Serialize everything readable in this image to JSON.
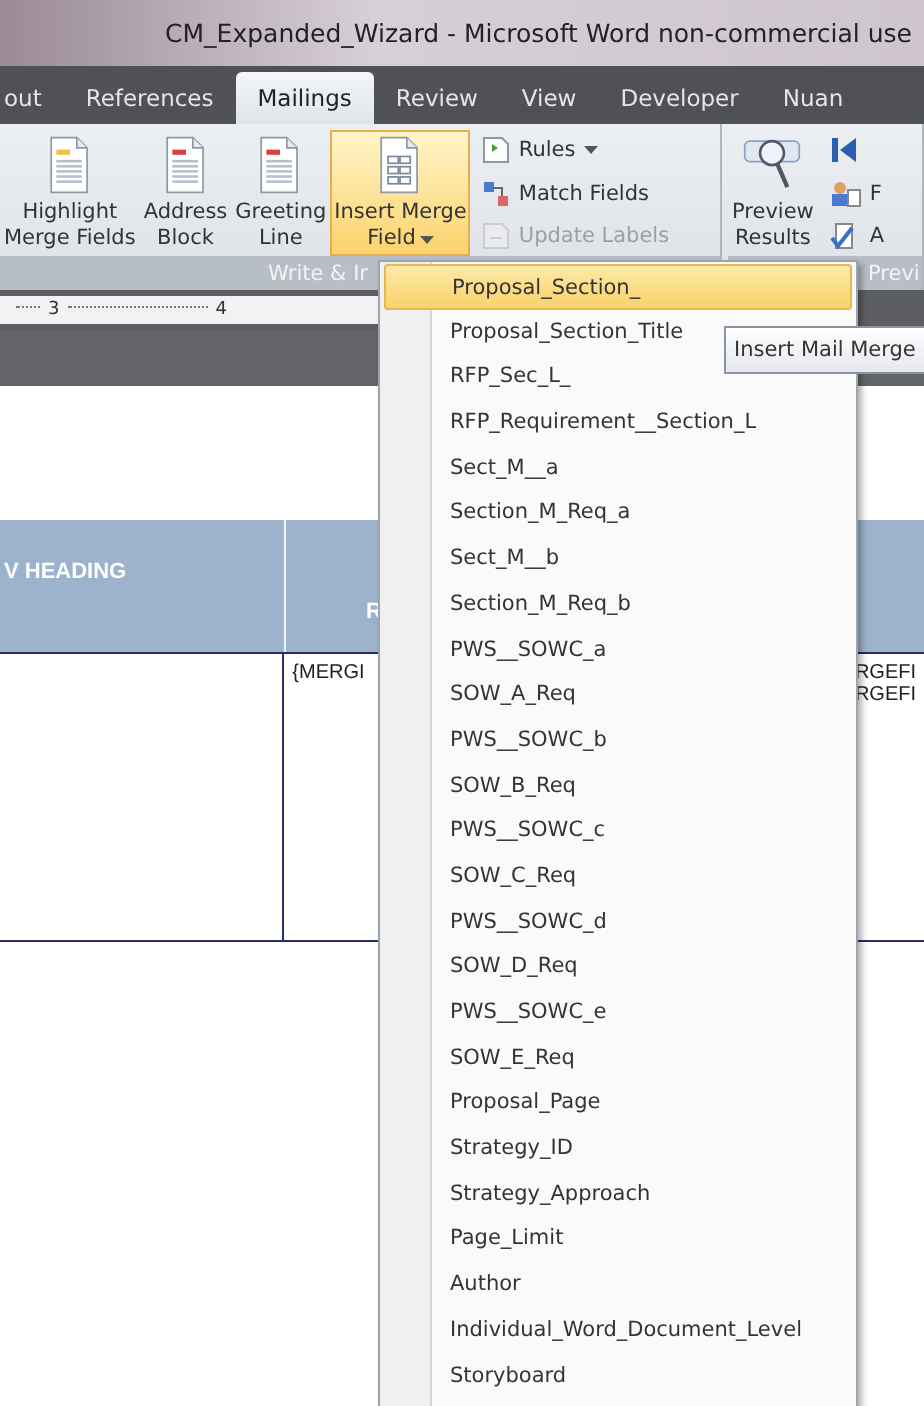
{
  "window": {
    "title": "CM_Expanded_Wizard - Microsoft Word non-commercial use"
  },
  "tabs": [
    {
      "label": "out",
      "selected": false
    },
    {
      "label": "References",
      "selected": false
    },
    {
      "label": "Mailings",
      "selected": true
    },
    {
      "label": "Review",
      "selected": false
    },
    {
      "label": "View",
      "selected": false
    },
    {
      "label": "Developer",
      "selected": false
    },
    {
      "label": "Nuan",
      "selected": false
    }
  ],
  "ribbon": {
    "groups": [
      {
        "label": "Write & Ir",
        "large_buttons": [
          {
            "kind": "highlight",
            "lines": [
              "Highlight",
              "Merge Fields"
            ],
            "pressed": false,
            "dropdown": false
          },
          {
            "kind": "address",
            "lines": [
              "Address",
              "Block"
            ],
            "pressed": false,
            "dropdown": false
          },
          {
            "kind": "greeting",
            "lines": [
              "Greeting",
              "Line"
            ],
            "pressed": false,
            "dropdown": false
          },
          {
            "kind": "field",
            "lines": [
              "Insert Merge",
              "Field"
            ],
            "pressed": true,
            "dropdown": true
          }
        ],
        "small_buttons": [
          {
            "kind": "rules",
            "label": "Rules",
            "disabled": false,
            "dropdown": true
          },
          {
            "kind": "match",
            "label": "Match Fields",
            "disabled": false,
            "dropdown": false
          },
          {
            "kind": "update",
            "label": "Update Labels",
            "disabled": true,
            "dropdown": false
          }
        ]
      },
      {
        "label": "Previ",
        "large_buttons": [
          {
            "kind": "preview",
            "lines": [
              "Preview",
              "Results"
            ],
            "pressed": false,
            "dropdown": false
          }
        ],
        "small_buttons": [
          {
            "kind": "first",
            "disabled": false,
            "dropdown": false
          },
          {
            "kind": "find",
            "label": "F",
            "disabled": false,
            "dropdown": false
          },
          {
            "kind": "check",
            "label": "A",
            "disabled": false,
            "dropdown": false
          }
        ]
      }
    ]
  },
  "ruler": {
    "marks": [
      "3",
      "4"
    ]
  },
  "table": {
    "header": {
      "column_1": "V HEADING",
      "column_2": "R"
    },
    "rows": [
      {
        "column_2": [
          "{MERGI"
        ],
        "column_3": [
          "RGEFI",
          "RGEFI"
        ]
      }
    ]
  },
  "menu": {
    "items": [
      {
        "label": "Proposal_Section_",
        "selected": true
      },
      {
        "label": "Proposal_Section_Title",
        "selected": false
      },
      {
        "label": "RFP_Sec_L_",
        "selected": false
      },
      {
        "label": "RFP_Requirement__Section_L",
        "selected": false
      },
      {
        "label": "Sect_M__a",
        "selected": false
      },
      {
        "label": "Section_M_Req_a",
        "selected": false
      },
      {
        "label": "Sect_M__b",
        "selected": false
      },
      {
        "label": "Section_M_Req_b",
        "selected": false
      },
      {
        "label": "PWS__SOWC_a",
        "selected": false
      },
      {
        "label": "SOW_A_Req",
        "selected": false
      },
      {
        "label": "PWS__SOWC_b",
        "selected": false
      },
      {
        "label": "SOW_B_Req",
        "selected": false
      },
      {
        "label": "PWS__SOWC_c",
        "selected": false
      },
      {
        "label": "SOW_C_Req",
        "selected": false
      },
      {
        "label": "PWS__SOWC_d",
        "selected": false
      },
      {
        "label": "SOW_D_Req",
        "selected": false
      },
      {
        "label": "PWS__SOWC_e",
        "selected": false
      },
      {
        "label": "SOW_E_Req",
        "selected": false
      },
      {
        "label": "Proposal_Page",
        "selected": false
      },
      {
        "label": "Strategy_ID",
        "selected": false
      },
      {
        "label": "Strategy_Approach",
        "selected": false
      },
      {
        "label": "Page_Limit",
        "selected": false
      },
      {
        "label": "Author",
        "selected": false
      },
      {
        "label": "Individual_Word_Document_Level",
        "selected": false
      },
      {
        "label": "Storyboard",
        "selected": false
      }
    ]
  },
  "tooltip": {
    "text": "Insert Mail Merge"
  }
}
